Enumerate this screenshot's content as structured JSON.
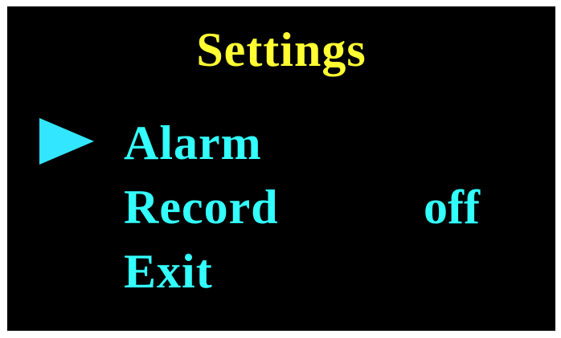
{
  "title": "Settings",
  "colors": {
    "background": "#000000",
    "title": "#ffff33",
    "item": "#33ffff",
    "cursor": "#33e6ff"
  },
  "cursor_icon": "triangle-right-icon",
  "selected_index": 0,
  "menu": {
    "items": [
      {
        "label": "Alarm",
        "value": ""
      },
      {
        "label": "Record",
        "value": "off"
      },
      {
        "label": "Exit",
        "value": ""
      }
    ]
  }
}
